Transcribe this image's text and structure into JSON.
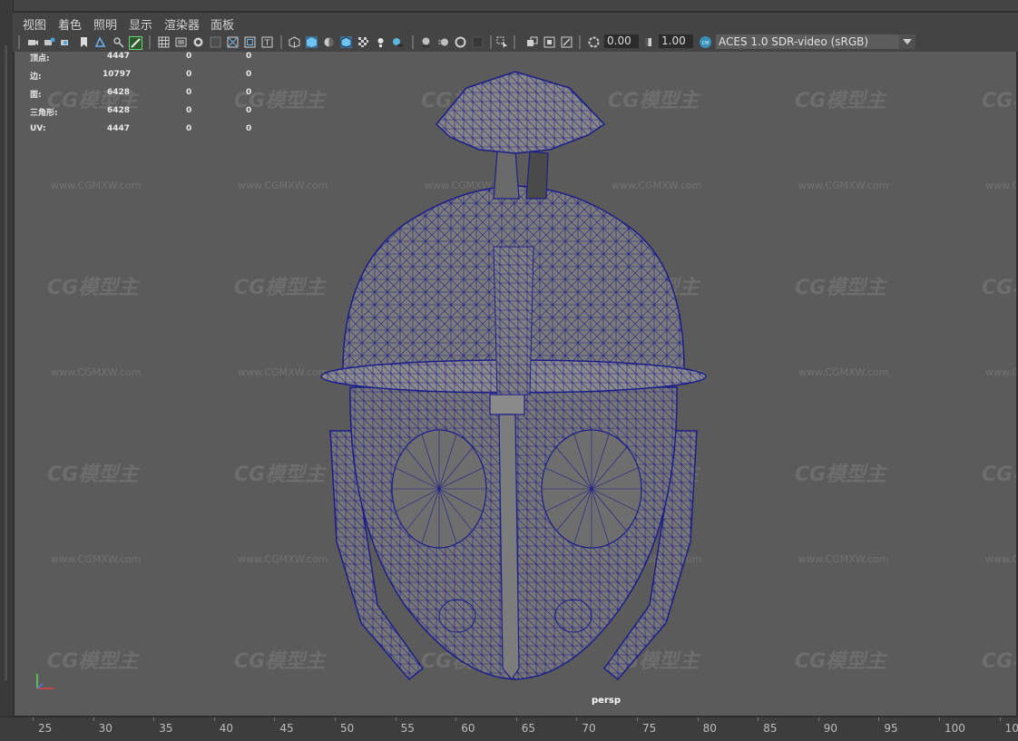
{
  "menu": {
    "items": [
      "视图",
      "着色",
      "照明",
      "显示",
      "渲染器",
      "面板"
    ]
  },
  "toolbar": {
    "field_1": "0.00",
    "field_2": "1.00",
    "color_management": "ACES 1.0 SDR-video (sRGB)",
    "icons": [
      "select-camera-icon",
      "camera-attr-icon",
      "bookmark-icon",
      "image-plane-icon",
      "2d-pan-icon",
      "grease-pencil-icon",
      "grid-icon",
      "film-gate-icon",
      "resolution-gate-icon",
      "gate-mask-icon",
      "field-chart-icon",
      "safe-action-icon",
      "safe-title-icon",
      "wireframe-icon",
      "smooth-shade-icon",
      "smooth-wireframe-icon",
      "textured-icon",
      "lighting-icon",
      "shadows-icon",
      "screen-space-ao-icon",
      "motion-blur-icon",
      "multisample-icon",
      "depth-of-field-icon",
      "isolate-select-icon",
      "xray-icon",
      "xray-joints-icon",
      "backface-icon",
      "exposure-icon",
      "gamma-icon",
      "ocio-icon"
    ]
  },
  "hud": {
    "rows": [
      {
        "label": "顶点:",
        "v1": "4447",
        "v2": "0",
        "v3": "0"
      },
      {
        "label": "边:",
        "v1": "10797",
        "v2": "0",
        "v3": "0"
      },
      {
        "label": "面:",
        "v1": "6428",
        "v2": "0",
        "v3": "0"
      },
      {
        "label": "三角形:",
        "v1": "6428",
        "v2": "0",
        "v3": "0"
      },
      {
        "label": "UV:",
        "v1": "4447",
        "v2": "0",
        "v3": "0"
      }
    ]
  },
  "viewport": {
    "camera_label": "persp",
    "watermark_logo": "CG模型主",
    "watermark_url": "www.CGMXW.com",
    "mesh_color": "#1d1d8a",
    "mesh_fill": "#767676"
  },
  "timeline": {
    "ticks": [
      "25",
      "30",
      "35",
      "40",
      "45",
      "50",
      "55",
      "60",
      "65",
      "70",
      "75",
      "80",
      "85",
      "90",
      "95",
      "100",
      "10"
    ]
  }
}
